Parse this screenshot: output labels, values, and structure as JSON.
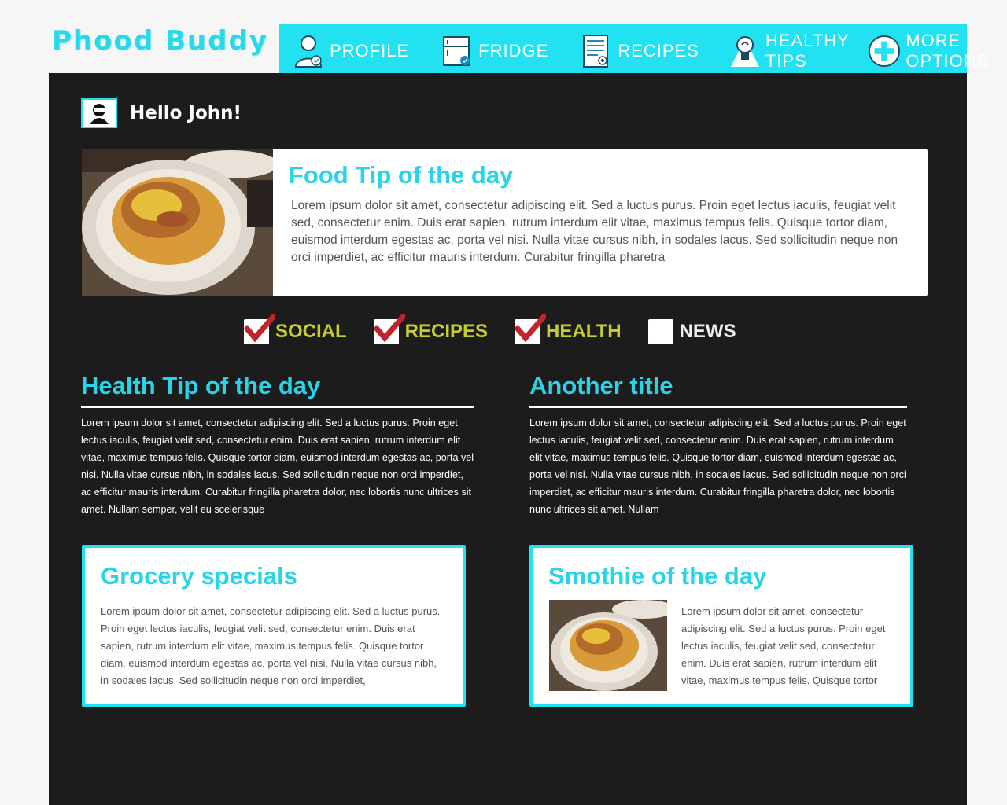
{
  "app": {
    "logo": "Phood Buddy"
  },
  "nav": {
    "items": [
      {
        "label": "PROFILE",
        "icon": "profile-icon"
      },
      {
        "label": "FRIDGE",
        "icon": "fridge-icon"
      },
      {
        "label": "RECIPES",
        "icon": "recipes-icon"
      },
      {
        "label": "HEALTHY TIPS",
        "icon": "lightbulb-icon"
      },
      {
        "label": "MORE OPTIONS",
        "icon": "plus-icon"
      }
    ]
  },
  "greeting": "Hello John!",
  "food_tip": {
    "title": "Food Tip of the day",
    "text": "Lorem ipsum dolor sit amet, consectetur adipiscing elit. Sed a luctus purus. Proin eget lectus iaculis, feugiat velit sed, consectetur enim. Duis erat sapien, rutrum interdum elit vitae, maximus tempus felis. Quisque tortor diam, euismod interdum egestas ac, porta vel nisi. Nulla vitae cursus nibh, in sodales lacus. Sed sollicitudin neque non orci imperdiet, ac efficitur mauris interdum. Curabitur fringilla pharetra"
  },
  "filters": [
    {
      "label": "SOCIAL",
      "checked": true
    },
    {
      "label": "RECIPES",
      "checked": true
    },
    {
      "label": "HEALTH",
      "checked": true
    },
    {
      "label": "NEWS",
      "checked": false
    }
  ],
  "health_tip": {
    "title": "Health Tip of the day",
    "text": "Lorem ipsum dolor sit amet, consectetur adipiscing elit. Sed a luctus purus. Proin eget lectus iaculis, feugiat velit sed, consectetur enim. Duis erat sapien, rutrum interdum elit vitae, maximus tempus felis. Quisque tortor diam, euismod interdum egestas ac, porta vel nisi. Nulla vitae cursus nibh, in sodales lacus. Sed sollicitudin neque non orci imperdiet, ac efficitur mauris interdum. Curabitur fringilla pharetra dolor, nec lobortis nunc ultrices sit amet. Nullam semper, velit eu scelerisque"
  },
  "another": {
    "title": "Another title",
    "text": "Lorem ipsum dolor sit amet, consectetur adipiscing elit. Sed a luctus purus. Proin eget lectus iaculis, feugiat velit sed, consectetur enim. Duis erat sapien, rutrum interdum elit vitae, maximus tempus felis. Quisque tortor diam, euismod interdum egestas ac, porta vel nisi. Nulla vitae cursus nibh, in sodales lacus. Sed sollicitudin neque non orci imperdiet, ac efficitur mauris interdum. Curabitur fringilla pharetra dolor, nec lobortis nunc ultrices sit amet. Nullam"
  },
  "grocery": {
    "title": "Grocery specials",
    "text": "Lorem ipsum dolor sit amet, consectetur adipiscing elit. Sed a luctus purus. Proin eget lectus iaculis, feugiat velit sed, consectetur enim. Duis erat sapien, rutrum interdum elit vitae, maximus tempus felis. Quisque tortor diam, euismod interdum egestas ac, porta vel nisi. Nulla vitae cursus nibh, in sodales lacus. Sed sollicitudin neque non orci imperdiet,"
  },
  "smoothie": {
    "title": "Smothie of the day",
    "text": "Lorem ipsum dolor sit amet, consectetur adipiscing elit. Sed a luctus purus. Proin eget lectus iaculis, feugiat velit sed, consectetur enim. Duis erat sapien, rutrum interdum elit vitae, maximus tempus felis. Quisque tortor"
  },
  "colors": {
    "accent": "#22e1f0",
    "heading": "#29d3e8",
    "panel": "#1c1c1c",
    "filter_active": "#c7cc2f",
    "filter_inactive": "#ffffff",
    "check": "#c0242c"
  }
}
